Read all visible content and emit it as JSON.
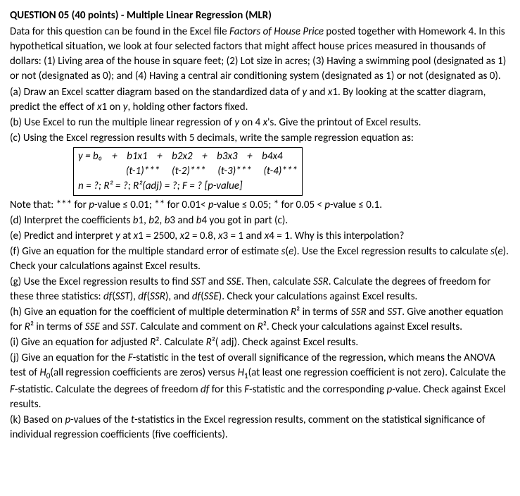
{
  "title": "QUESTION 05 (40 points) - Multiple Linear Regression (MLR)",
  "intro": {
    "line1a": "Data for this question can be found in the Excel file ",
    "line1b": "Factors of House Price",
    "line1c": " posted together with Homework 4. In this hypothetical situation, we look at four selected factors that might affect house prices measured in thousands of dollars: (1) Living area of the house in square feet; (2) Lot size in acres; (3) Having a swimming pool (designated as 1) or not (designated as 0); and (4) Having a central air conditioning system (designated as 1) or not (designated as 0)."
  },
  "parts": {
    "a": "(a) Draw an Excel scatter diagram based on the standardized data of ",
    "a_y": "y",
    "a_and": " and ",
    "a_x1": "x",
    "a_1": "1. By looking at the scatter diagram, predict the effect of ",
    "a_x1b": "x",
    "a_1b": "1 on ",
    "a_yb": "y",
    "a_end": ", holding other factors fixed.",
    "b": "(b) Use Excel to run the multiple linear regression of ",
    "b_y": "y",
    "b_on": " on 4 ",
    "b_x": "x",
    "b_end": "'s. Give the printout of Excel results.",
    "c": "(c) Using the Excel regression results with 5 decimals, write the sample regression equation as:",
    "eq_row1": "y = b₀    +    b1x1    +    b2x2    +    b3x3    +    b4x4",
    "eq_row2": "                    (t-1)***     (t-2)***     (t-3)***     (t-4)***",
    "eq_row3": "n = ?; R² = ?; R²(adj) = ?; F = ? [p-value]",
    "note1": "Note that: *** for ",
    "note_p1": "p",
    "note2": "-value ≤ 0.01; ** for 0.01< ",
    "note_p2": "p",
    "note3": "-value ≤ 0.05; * for 0.05 < ",
    "note_p3": "p",
    "note4": "-value ≤ 0.1.",
    "d": "(d) Interpret the coefficients ",
    "d_b1": "b",
    "d_1": "1, ",
    "d_b2": "b",
    "d_2": "2, ",
    "d_b3": "b",
    "d_3": "3 and ",
    "d_b4": "b",
    "d_4": "4 you got in part (c).",
    "e": "(e) Predict and interpret ",
    "e_y": "y",
    "e_at": " at ",
    "e_x1": "x",
    "e_1": "1 = 2500, ",
    "e_x2": "x",
    "e_2": "2 = 0.8, ",
    "e_x3": "x",
    "e_3": "3 = 1 and ",
    "e_x4": "x",
    "e_4": "4 = 1. Why is this interpolation?",
    "f": "(f) Give an equation for the multiple standard error of estimate ",
    "f_se": "s",
    "f_e": "e",
    "f_mid": "). Use the Excel regression results to calculate ",
    "f_se2": "s",
    "f_e2": "e",
    "f_end": "). Check your calculations against Excel results.",
    "g": "(g) Use the Excel regression results to find ",
    "g_sst": "SST",
    "g_and": " and ",
    "g_sse": "SSE",
    "g_then": ". Then, calculate ",
    "g_ssr": "SSR",
    "g_calc": ". Calculate the degrees of freedom for these three statistics: ",
    "g_df1": "df",
    "g_sst2": "SST",
    "g_c1": "), ",
    "g_df2": "df",
    "g_ssr2": "SSR",
    "g_c2": "), and ",
    "g_df3": "df",
    "g_sse2": "SSE",
    "g_end": "). Check your calculations against Excel results.",
    "h": "(h) Give an equation for the coefficient of multiple determination ",
    "h_r2": "R",
    "h_in": " in terms of ",
    "h_ssr": "SSR",
    "h_and": " and ",
    "h_sst": "SST",
    "h_give": ". Give another equation for ",
    "h_r2b": "R",
    "h_in2": " in terms of ",
    "h_sse": "SSE",
    "h_and2": " and ",
    "h_sst2": "SST",
    "h_calc": ". Calculate and comment on ",
    "h_r2c": "R",
    "h_end": ". Check your calculations against Excel results.",
    "i": "(i) Give an equation for adjusted ",
    "i_r2": "R",
    "i_calc": ". Calculate ",
    "i_r2b": "R",
    "i_end": "( adj). Check against Excel results.",
    "j": "(j) Give an equation for the ",
    "j_f": "F",
    "j_stat": "-statistic in the test of overall significance of the regression, which means the ANOVA test of ",
    "j_h0": "H",
    "j_h0txt": "(all regression coefficients are zeros) versus ",
    "j_h1": "H",
    "j_h1txt": "(at least one regression coefficient is not zero). Calculate the ",
    "j_f2": "F",
    "j_stat2": "-statistic. Calculate the degrees of freedom ",
    "j_df": "df",
    "j_for": " for this ",
    "j_f3": "F",
    "j_stat3": "-statistic and the corresponding ",
    "j_p": "p",
    "j_end": "-value. Check against Excel results.",
    "k": "(k) Based on ",
    "k_p": "p",
    "k_val": "-values of the ",
    "k_t": "t",
    "k_end": "-statistics in the Excel regression results, comment on the statistical significance of individual regression coefficients (five coefficients)."
  }
}
